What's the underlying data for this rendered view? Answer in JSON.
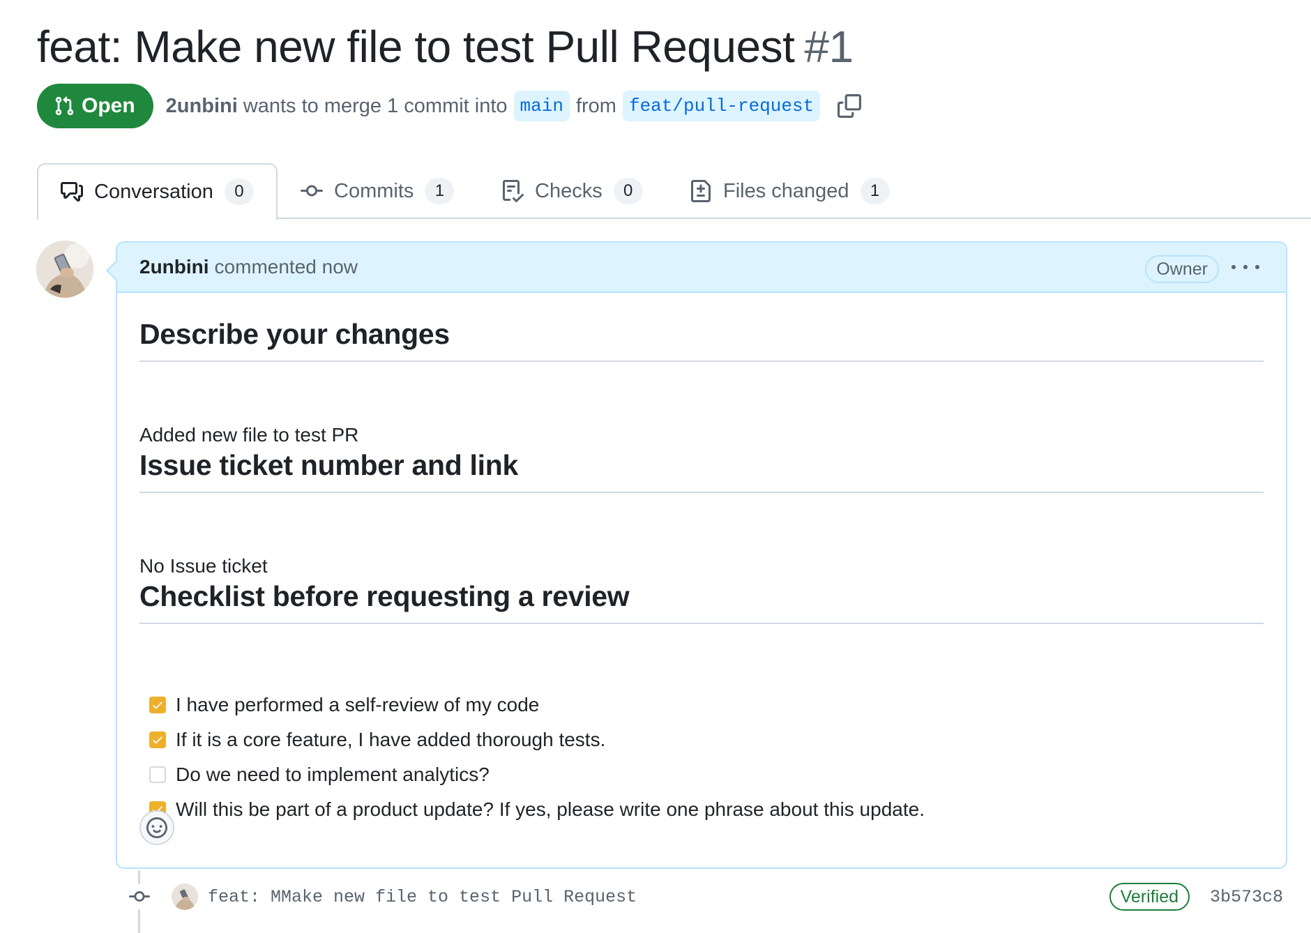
{
  "pr": {
    "title": "feat: Make new file to test Pull Request",
    "number": "#1",
    "state": "Open",
    "author": "2unbini",
    "merge_text": "wants to merge 1 commit into",
    "base_branch": "main",
    "from_text": "from",
    "head_branch": "feat/pull-request"
  },
  "tabs": [
    {
      "label": "Conversation",
      "count": "0",
      "icon": "comment-discussion-icon",
      "active": true
    },
    {
      "label": "Commits",
      "count": "1",
      "icon": "git-commit-icon",
      "active": false
    },
    {
      "label": "Checks",
      "count": "0",
      "icon": "checklist-icon",
      "active": false
    },
    {
      "label": "Files changed",
      "count": "1",
      "icon": "file-diff-icon",
      "active": false
    }
  ],
  "comment": {
    "author": "2unbini",
    "action": "commented now",
    "role_badge": "Owner",
    "sections": [
      {
        "heading": "Describe your changes",
        "text": "Added new file to test PR"
      },
      {
        "heading": "Issue ticket number and link",
        "text": "No Issue ticket"
      },
      {
        "heading": "Checklist before requesting a review"
      }
    ],
    "checklist": [
      {
        "label": "I have performed a self-review of my code",
        "checked": true
      },
      {
        "label": "If it is a core feature, I have added thorough tests.",
        "checked": true
      },
      {
        "label": "Do we need to implement analytics?",
        "checked": false
      },
      {
        "label": "Will this be part of a product update? If yes, please write one phrase about this update.",
        "checked": true
      }
    ]
  },
  "commit": {
    "message": "feat: MMake new file to test Pull Request",
    "verified_label": "Verified",
    "sha": "3b573c8"
  },
  "colors": {
    "open_green": "#1f883d",
    "link_blue": "#0969da",
    "comment_header_bg": "#ddf4ff",
    "checkbox_checked": "#eeb02b",
    "verified_green": "#1a7f37"
  }
}
